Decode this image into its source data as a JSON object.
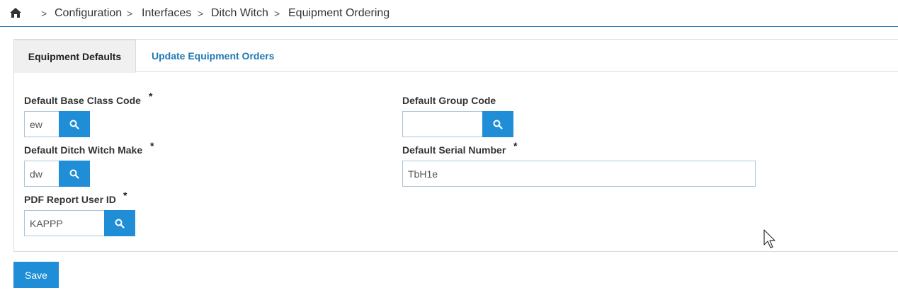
{
  "breadcrumb": {
    "home_icon": "home-icon",
    "separator": ">",
    "items": [
      "Configuration",
      "Interfaces",
      "Ditch Witch",
      "Equipment Ordering"
    ]
  },
  "tabs": [
    {
      "label": "Equipment Defaults",
      "active": true
    },
    {
      "label": "Update Equipment Orders",
      "active": false
    }
  ],
  "form": {
    "required_marker": "*",
    "base_class_code": {
      "label": "Default Base Class Code",
      "value": "ew",
      "required": true
    },
    "group_code": {
      "label": "Default Group Code",
      "value": "",
      "required": false
    },
    "ditch_witch_make": {
      "label": "Default Ditch Witch Make",
      "value": "dw",
      "required": true
    },
    "serial_number": {
      "label": "Default Serial Number",
      "value": "TbH1e",
      "required": true
    },
    "pdf_report_user_id": {
      "label": "PDF Report User ID",
      "value": "KAPPP",
      "required": true
    }
  },
  "actions": {
    "save_label": "Save"
  },
  "colors": {
    "accent": "#1f8ed6",
    "link": "#1f78b4",
    "border": "#2a7bb4"
  }
}
